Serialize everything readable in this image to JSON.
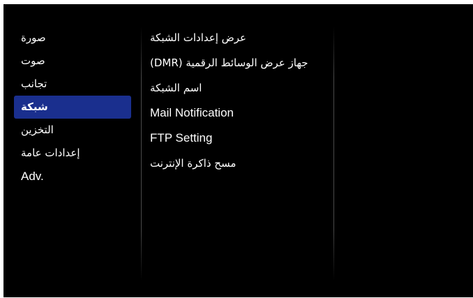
{
  "left_menu": {
    "items": [
      {
        "label": "صورة",
        "selected": false
      },
      {
        "label": "صوت",
        "selected": false
      },
      {
        "label": "تجانب",
        "selected": false
      },
      {
        "label": "شبكة",
        "selected": true
      },
      {
        "label": "التخزين",
        "selected": false
      },
      {
        "label": "إعدادات عامة",
        "selected": false
      },
      {
        "label": "Adv.",
        "selected": false
      }
    ]
  },
  "right_menu": {
    "items": [
      {
        "label": "عرض إعدادات الشبكة"
      },
      {
        "label": "جهاز عرض الوسائط الرقمية (DMR)"
      },
      {
        "label": "اسم الشبكة"
      },
      {
        "label": "Mail Notification"
      },
      {
        "label": "FTP Setting"
      },
      {
        "label": "مسح ذاكرة الإنترنت"
      }
    ]
  },
  "colors": {
    "background": "#000000",
    "selection": "#1a2f8e",
    "text": "#ffffff"
  }
}
